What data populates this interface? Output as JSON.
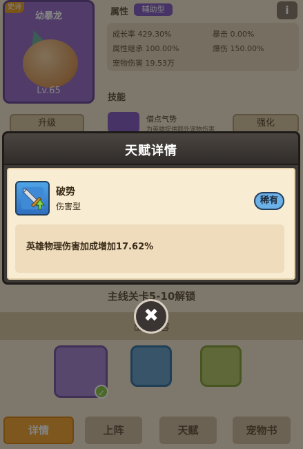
{
  "pet": {
    "rarity_tag": "史诗",
    "name": "幼暴龙",
    "level": "Lv.65",
    "attr_title": "属性",
    "attr_type": "辅助型",
    "info_icon": "i",
    "stats": [
      {
        "label": "成长率",
        "value": "429.30%"
      },
      {
        "label": "暴击",
        "value": "0.00%"
      },
      {
        "label": "属性继承",
        "value": "100.00%"
      },
      {
        "label": "爆伤",
        "value": "150.00%"
      },
      {
        "label": "宠物伤害",
        "value": "19.53万"
      }
    ],
    "skill_title": "技能",
    "skill_name": "借点气势",
    "skill_desc": "为英雄提供额外宠物伤害",
    "upgrade_button": "升级",
    "enhance_button": "强化"
  },
  "unlock_text": "主线关卡5-10解锁",
  "lineup_label": "出战阵容",
  "bottom_tabs": [
    "详情",
    "上阵",
    "天赋",
    "宠物书"
  ],
  "modal": {
    "title": "天赋详情",
    "talent": {
      "icon": "sword-up-icon",
      "name": "破势",
      "type": "伤害型",
      "rarity": "稀有",
      "effect": "英雄物理伤害加成增加17.62%"
    },
    "close_icon": "✖"
  },
  "colors": {
    "modal_frame": "#3d3935",
    "modal_body": "#f8ecd2",
    "effect_box": "#efdcbc",
    "rarity_badge": "#6bb1e8",
    "active_tab": "#f0a83a",
    "pet_card": "#9c74c9"
  }
}
